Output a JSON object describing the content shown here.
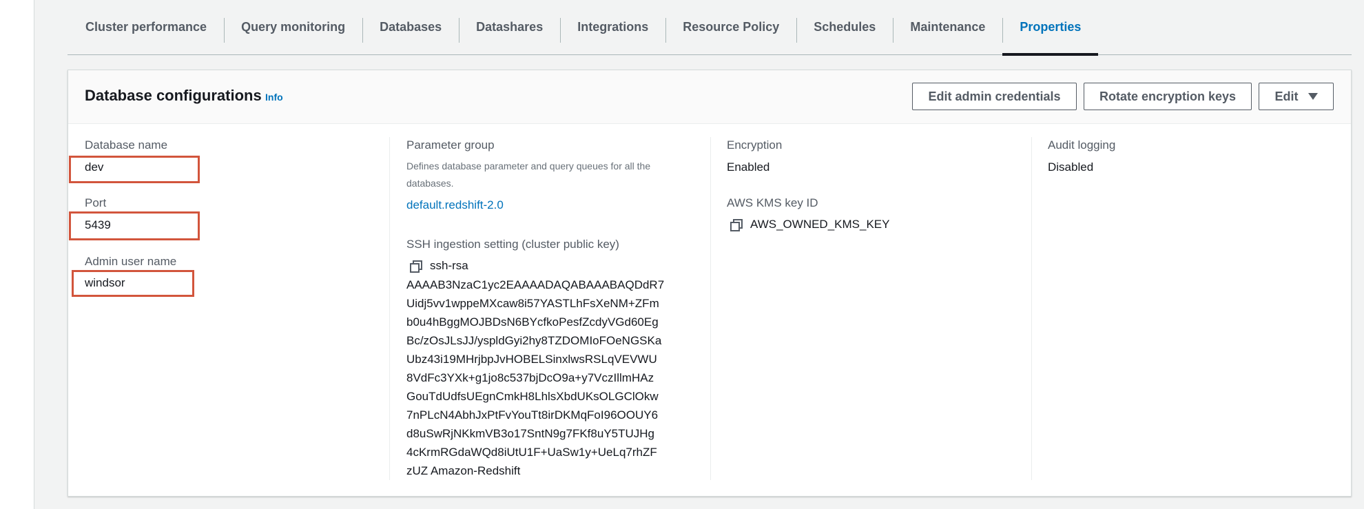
{
  "tabs": [
    {
      "label": "Cluster performance",
      "active": false
    },
    {
      "label": "Query monitoring",
      "active": false
    },
    {
      "label": "Databases",
      "active": false
    },
    {
      "label": "Datashares",
      "active": false
    },
    {
      "label": "Integrations",
      "active": false
    },
    {
      "label": "Resource Policy",
      "active": false
    },
    {
      "label": "Schedules",
      "active": false
    },
    {
      "label": "Maintenance",
      "active": false
    },
    {
      "label": "Properties",
      "active": true
    }
  ],
  "panel": {
    "title": "Database configurations",
    "info_label": "Info",
    "buttons": {
      "edit_admin": "Edit admin credentials",
      "rotate_keys": "Rotate encryption keys",
      "edit": "Edit"
    }
  },
  "database": {
    "name_label": "Database name",
    "name_value": "dev",
    "port_label": "Port",
    "port_value": "5439",
    "admin_label": "Admin user name",
    "admin_value": "windsor"
  },
  "parameter_group": {
    "label": "Parameter group",
    "description": "Defines database parameter and query queues for all the databases.",
    "link": "default.redshift-2.0"
  },
  "ssh": {
    "label": "SSH ingestion setting (cluster public key)",
    "first_line": "ssh-rsa",
    "lines": [
      "AAAAB3NzaC1yc2EAAAADAQABAAABAQDdR7",
      "Uidj5vv1wppeMXcaw8i57YASTLhFsXeNM+ZFm",
      "b0u4hBggMOJBDsN6BYcfkoPesfZcdyVGd60Eg",
      "Bc/zOsJLsJJ/yspldGyi2hy8TZDOMIoFOeNGSKa",
      "Ubz43i19MHrjbpJvHOBELSinxlwsRSLqVEVWU",
      "8VdFc3YXk+g1jo8c537bjDcO9a+y7VczIllmHAz",
      "GouTdUdfsUEgnCmkH8LhlsXbdUKsOLGClOkw",
      "7nPLcN4AbhJxPtFvYouTt8irDKMqFoI96OOUY6",
      "d8uSwRjNKkmVB3o17SntN9g7FKf8uY5TUJHg",
      "4cKrmRGdaWQd8iUtU1F+UaSw1y+UeLq7rhZF",
      "zUZ Amazon-Redshift"
    ]
  },
  "encryption": {
    "label": "Encryption",
    "value": "Enabled",
    "kms_label": "AWS KMS key ID",
    "kms_value": "AWS_OWNED_KMS_KEY"
  },
  "audit": {
    "label": "Audit logging",
    "value": "Disabled"
  },
  "colors": {
    "accent": "#0073bb",
    "highlight_box": "#d2553c"
  }
}
